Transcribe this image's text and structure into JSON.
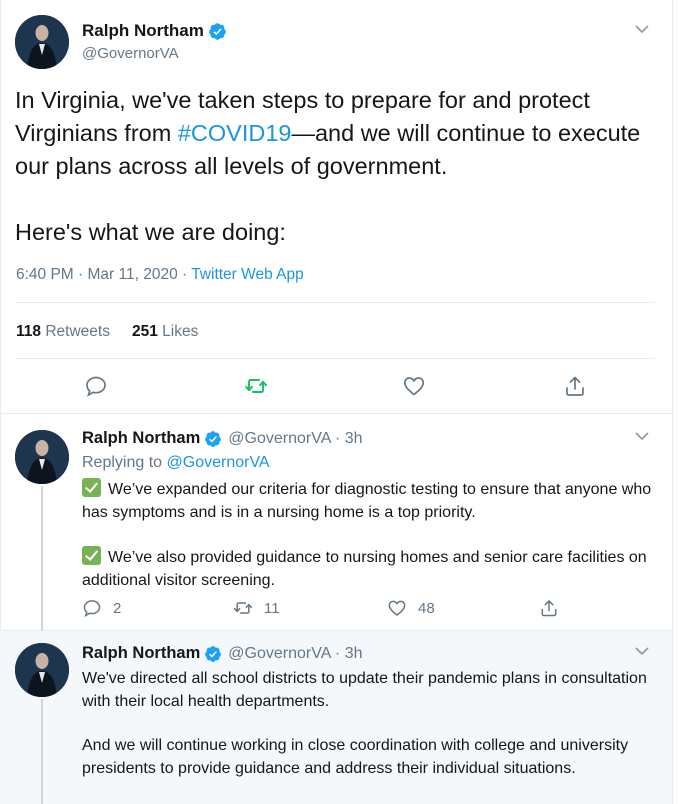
{
  "main_tweet": {
    "name": "Ralph Northam",
    "handle": "@GovernorVA",
    "text_before": "In Virginia, we've taken steps to prepare for and protect Virginians from ",
    "hashtag": "#COVID19",
    "text_after": "—and we will continue to execute our plans across all levels of government.\n\nHere's what we are doing:",
    "timestamp": "6:40 PM · Mar 11, 2020 · ",
    "source": "Twitter Web App",
    "retweets_count": "118",
    "retweets_label": "Retweets",
    "likes_count": "251",
    "likes_label": "Likes"
  },
  "replies": [
    {
      "name": "Ralph Northam",
      "handle": "@GovernorVA · 3h",
      "replying_prefix": "Replying to ",
      "replying_to": "@GovernorVA",
      "paragraph1": "We’ve expanded our criteria for diagnostic testing to ensure that anyone who has symptoms and is in a nursing home is a top priority.",
      "paragraph2": "We’ve also provided guidance to nursing homes and senior care facilities on additional visitor screening.",
      "reply_count": "2",
      "retweet_count": "11",
      "like_count": "48"
    },
    {
      "name": "Ralph Northam",
      "handle": "@GovernorVA · 3h",
      "paragraph1": "We've directed all school districts to update their pandemic plans in consultation with their local health departments.",
      "paragraph2": "And we will continue working in close coordination with college and university presidents to provide guidance and address their individual situations."
    }
  ],
  "colors": {
    "link_blue": "#1b95e0",
    "retweet_green": "#17bf63",
    "muted_gray": "#657786",
    "checkmark_green": "#77b255"
  },
  "icons": [
    "verified-badge-icon",
    "chevron-down-icon",
    "reply-icon",
    "retweet-icon",
    "like-icon",
    "share-icon",
    "check-mark-button-icon"
  ]
}
